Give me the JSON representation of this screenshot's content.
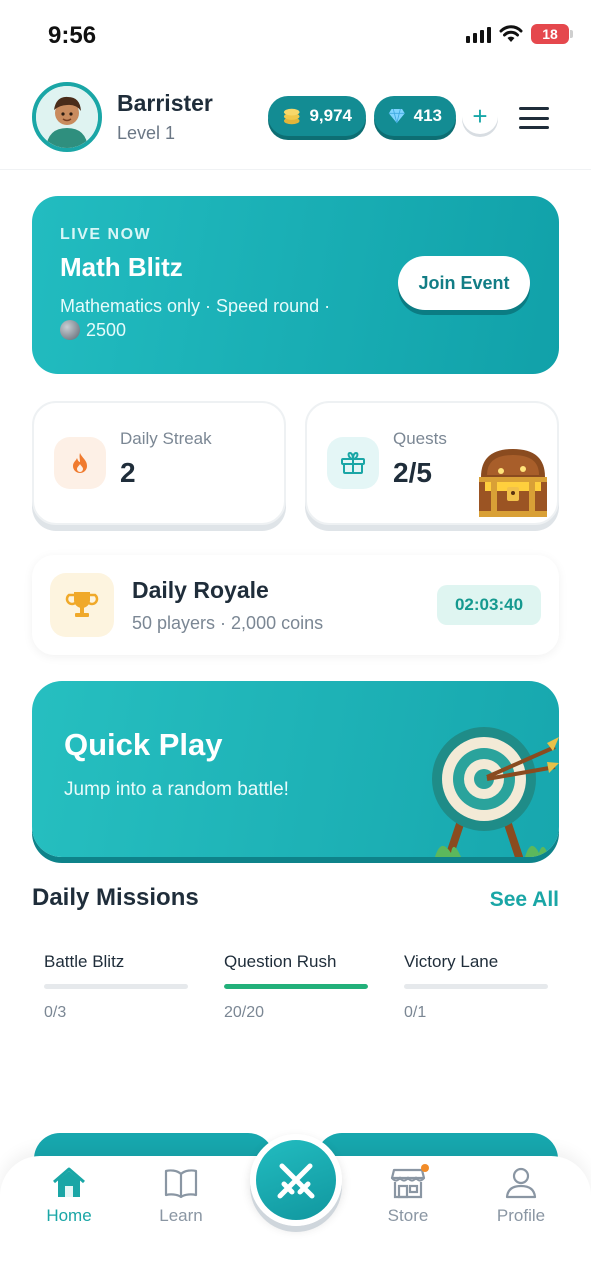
{
  "status_bar": {
    "time": "9:56",
    "battery": "18"
  },
  "user": {
    "name": "Barrister",
    "level": "Level 1"
  },
  "currency": {
    "coins": "9,974",
    "gems": "413",
    "add_label": "+"
  },
  "live_event": {
    "badge": "LIVE NOW",
    "title": "Math Blitz",
    "description": "Mathematics only · Speed round ·",
    "prize": "2500",
    "join_label": "Join Event"
  },
  "stats": {
    "streak": {
      "label": "Daily Streak",
      "value": "2"
    },
    "quests": {
      "label": "Quests",
      "value": "2/5"
    }
  },
  "daily_royale": {
    "title": "Daily Royale",
    "subtitle": "50 players · 2,000 coins",
    "timer": "02:03:40"
  },
  "quick_play": {
    "title": "Quick Play",
    "subtitle": "Jump into a random battle!"
  },
  "missions": {
    "title": "Daily Missions",
    "see_all": "See All",
    "items": [
      {
        "name": "Battle Blitz",
        "progress_text": "0/3",
        "progress": 0
      },
      {
        "name": "Question Rush",
        "progress_text": "20/20",
        "progress": 1
      },
      {
        "name": "Victory Lane",
        "progress_text": "0/1",
        "progress": 0
      }
    ]
  },
  "nav": {
    "items": [
      {
        "label": "Home",
        "icon": "home-icon",
        "active": true
      },
      {
        "label": "Learn",
        "icon": "book-icon",
        "active": false
      },
      {
        "label": "",
        "icon": "crossed-swords-icon",
        "active": false
      },
      {
        "label": "Store",
        "icon": "store-icon",
        "active": false
      },
      {
        "label": "Profile",
        "icon": "user-icon",
        "active": false
      }
    ]
  },
  "colors": {
    "accent": "#1aa6a6",
    "card_gradient_start": "#22bcc0",
    "card_gradient_end": "#11a1a9",
    "progress_green": "#22b07a",
    "battery_red": "#e5484d"
  }
}
